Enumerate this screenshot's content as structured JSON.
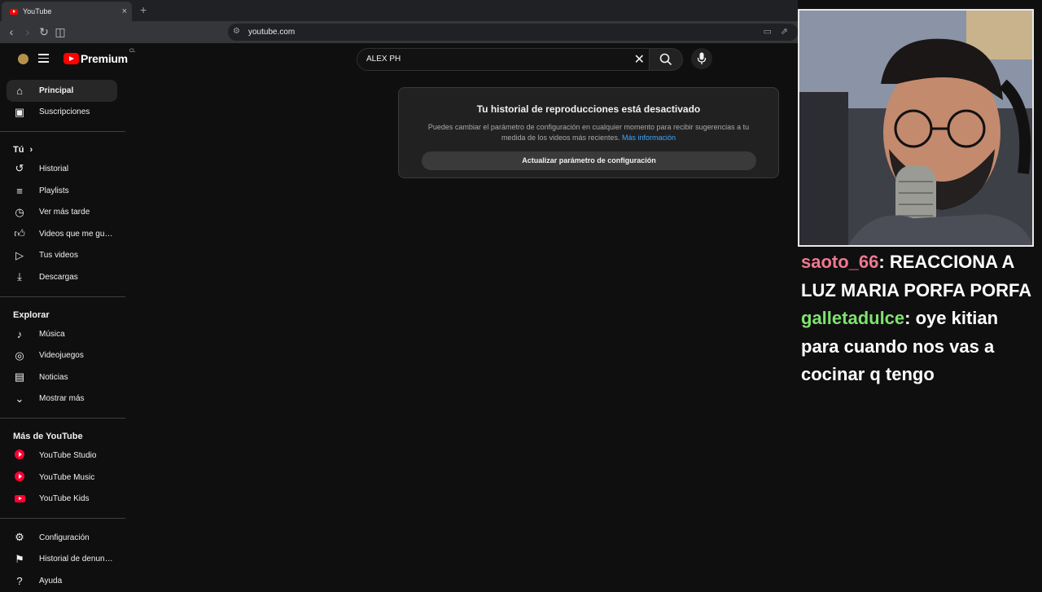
{
  "browser": {
    "tab_title": "YouTube",
    "tab_close": "×",
    "new_tab": "+",
    "url": "youtube.com"
  },
  "masthead": {
    "logo_text": "Premium",
    "country": "CL",
    "search_value": "ALEX PH",
    "clear_symbol": "✕"
  },
  "sidebar": {
    "main": [
      {
        "label": "Principal",
        "icon": "home-icon"
      },
      {
        "label": "Suscripciones",
        "icon": "subscriptions-icon"
      }
    ],
    "you_header": "Tú",
    "you_chevron": "›",
    "you": [
      {
        "label": "Historial",
        "icon": "history-icon"
      },
      {
        "label": "Playlists",
        "icon": "playlists-icon"
      },
      {
        "label": "Ver más tarde",
        "icon": "watch-later-icon"
      },
      {
        "label": "Videos que me gus...",
        "icon": "like-icon"
      },
      {
        "label": "Tus videos",
        "icon": "your-videos-icon"
      },
      {
        "label": "Descargas",
        "icon": "download-icon"
      }
    ],
    "explore_header": "Explorar",
    "explore": [
      {
        "label": "Música",
        "icon": "music-icon"
      },
      {
        "label": "Videojuegos",
        "icon": "gaming-icon"
      },
      {
        "label": "Noticias",
        "icon": "news-icon"
      },
      {
        "label": "Mostrar más",
        "icon": "chevron-down-icon"
      }
    ],
    "more_header": "Más de YouTube",
    "more": [
      {
        "label": "YouTube Studio",
        "icon": "youtube-studio-icon"
      },
      {
        "label": "YouTube Music",
        "icon": "youtube-music-icon"
      },
      {
        "label": "YouTube Kids",
        "icon": "youtube-kids-icon"
      }
    ],
    "bottom": [
      {
        "label": "Configuración",
        "icon": "gear-icon"
      },
      {
        "label": "Historial de denunc...",
        "icon": "flag-icon"
      },
      {
        "label": "Ayuda",
        "icon": "help-icon"
      }
    ]
  },
  "history_card": {
    "title": "Tu historial de reproducciones está desactivado",
    "description": "Puedes cambiar el parámetro de configuración en cualquier momento para recibir sugerencias a tu medida de los videos más recientes.",
    "link": "Más información",
    "button": "Actualizar parámetro de configuración"
  },
  "chat": {
    "messages": [
      {
        "user": "saoto_66",
        "text": "REACCIONA A LUZ MARIA PORFA PORFA",
        "color": "#ef7890"
      },
      {
        "user": "galletadulce",
        "text": "oye kitian para cuando nos vas a cocinar q tengo",
        "color": "#7fe26f"
      }
    ]
  },
  "colors": {
    "background": "#0f0f0f",
    "accent_red": "#ff0000",
    "link_blue": "#3ea6ff"
  }
}
